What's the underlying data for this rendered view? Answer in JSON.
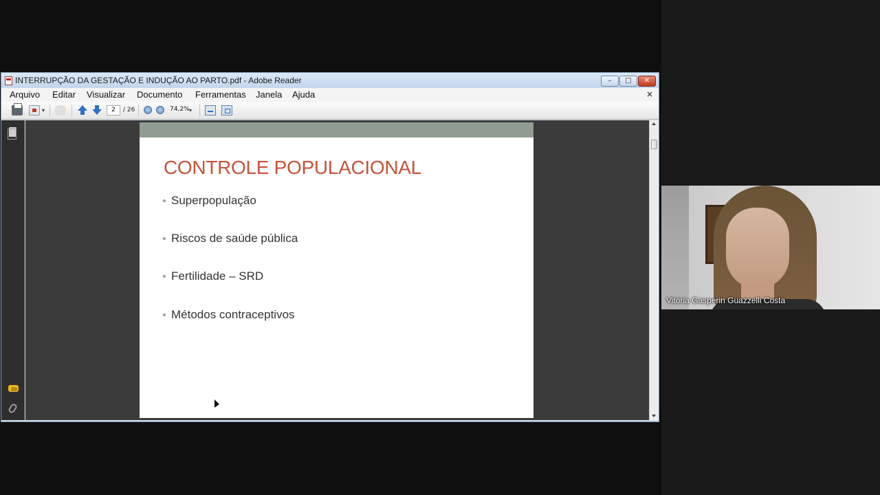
{
  "window": {
    "title": "INTERRUPÇÃO DA GESTAÇÃO E INDUÇÃO AO PARTO.pdf - Adobe Reader",
    "controls": {
      "minimize": "–",
      "maximize": "□",
      "close": "✕"
    }
  },
  "menu": {
    "items": [
      "Arquivo",
      "Editar",
      "Visualizar",
      "Documento",
      "Ferramentas",
      "Janela",
      "Ajuda"
    ],
    "close": "×"
  },
  "toolbar": {
    "current_page": "2",
    "total_pages": "/ 26",
    "zoom": "74,2%",
    "dropdown_arrow": "▾"
  },
  "slide": {
    "title": "CONTROLE POPULACIONAL",
    "bullets": [
      "Superpopulação",
      "Riscos de saúde pública",
      "Fertilidade – SRD",
      "Métodos contraceptivos"
    ]
  },
  "video": {
    "participant_name": "Vitória Gasperin Guazzelli Costa"
  },
  "colors": {
    "title_accent": "#c6533a",
    "page_band": "#919d92",
    "doc_background": "#3b3b3b"
  }
}
